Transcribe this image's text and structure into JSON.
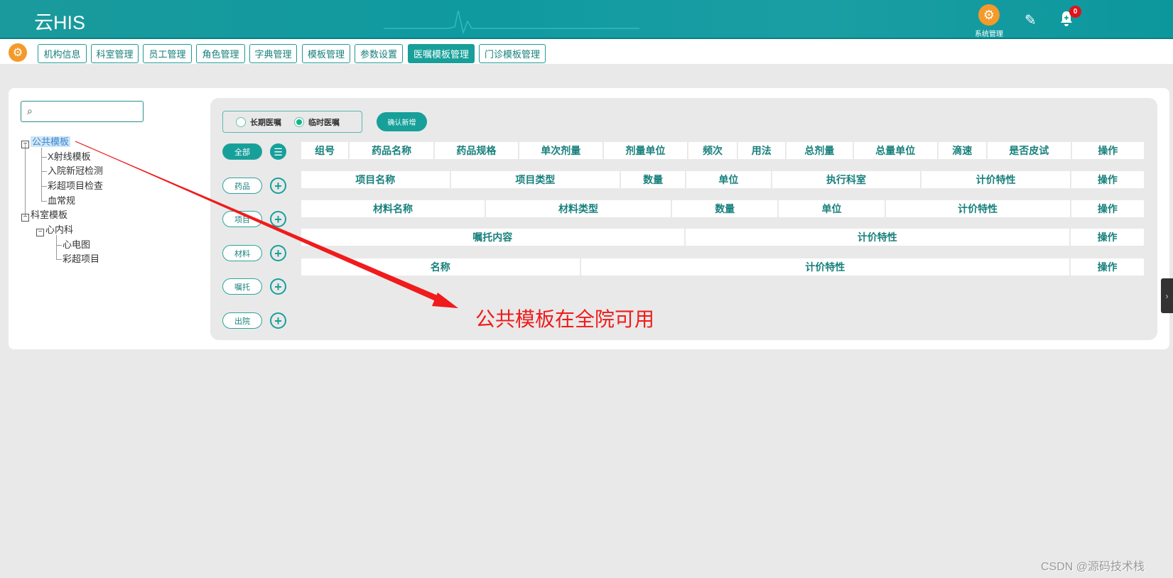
{
  "header": {
    "logo": "云HIS",
    "system_label": "系统管理",
    "notification_count": "0"
  },
  "nav": [
    "机构信息",
    "科室管理",
    "员工管理",
    "角色管理",
    "字典管理",
    "模板管理",
    "参数设置",
    "医嘱模板管理",
    "门诊模板管理"
  ],
  "nav_active": 7,
  "search": {
    "placeholder": ""
  },
  "tree": {
    "public": "公共模板",
    "public_children": [
      "X射线模板",
      "入院新冠检测",
      "彩超项目检查",
      "血常规"
    ],
    "dept": "科室模板",
    "cardio": "心内科",
    "cardio_children": [
      "心电图",
      "彩超项目"
    ]
  },
  "order_type": {
    "long": "长期医嘱",
    "temp": "临时医嘱",
    "selected": "临时医嘱"
  },
  "confirm_label": "确认新增",
  "categories": [
    "全部",
    "药品",
    "项目",
    "材料",
    "嘱托",
    "出院"
  ],
  "tables": [
    [
      "组号",
      "药品名称",
      "药品规格",
      "单次剂量",
      "剂量单位",
      "频次",
      "用法",
      "总剂量",
      "总量单位",
      "滴速",
      "是否皮试",
      "操作"
    ],
    [
      "项目名称",
      "项目类型",
      "数量",
      "单位",
      "执行科室",
      "计价特性",
      "操作"
    ],
    [
      "材料名称",
      "材料类型",
      "数量",
      "单位",
      "计价特性",
      "操作"
    ],
    [
      "嘱托内容",
      "计价特性",
      "操作"
    ],
    [
      "名称",
      "计价特性",
      "操作"
    ]
  ],
  "annotation": "公共模板在全院可用",
  "watermark": "CSDN @源码技术栈",
  "colors": {
    "teal": "#17a09a",
    "orange": "#f39a2a",
    "annotation_red": "#f01b1b"
  }
}
